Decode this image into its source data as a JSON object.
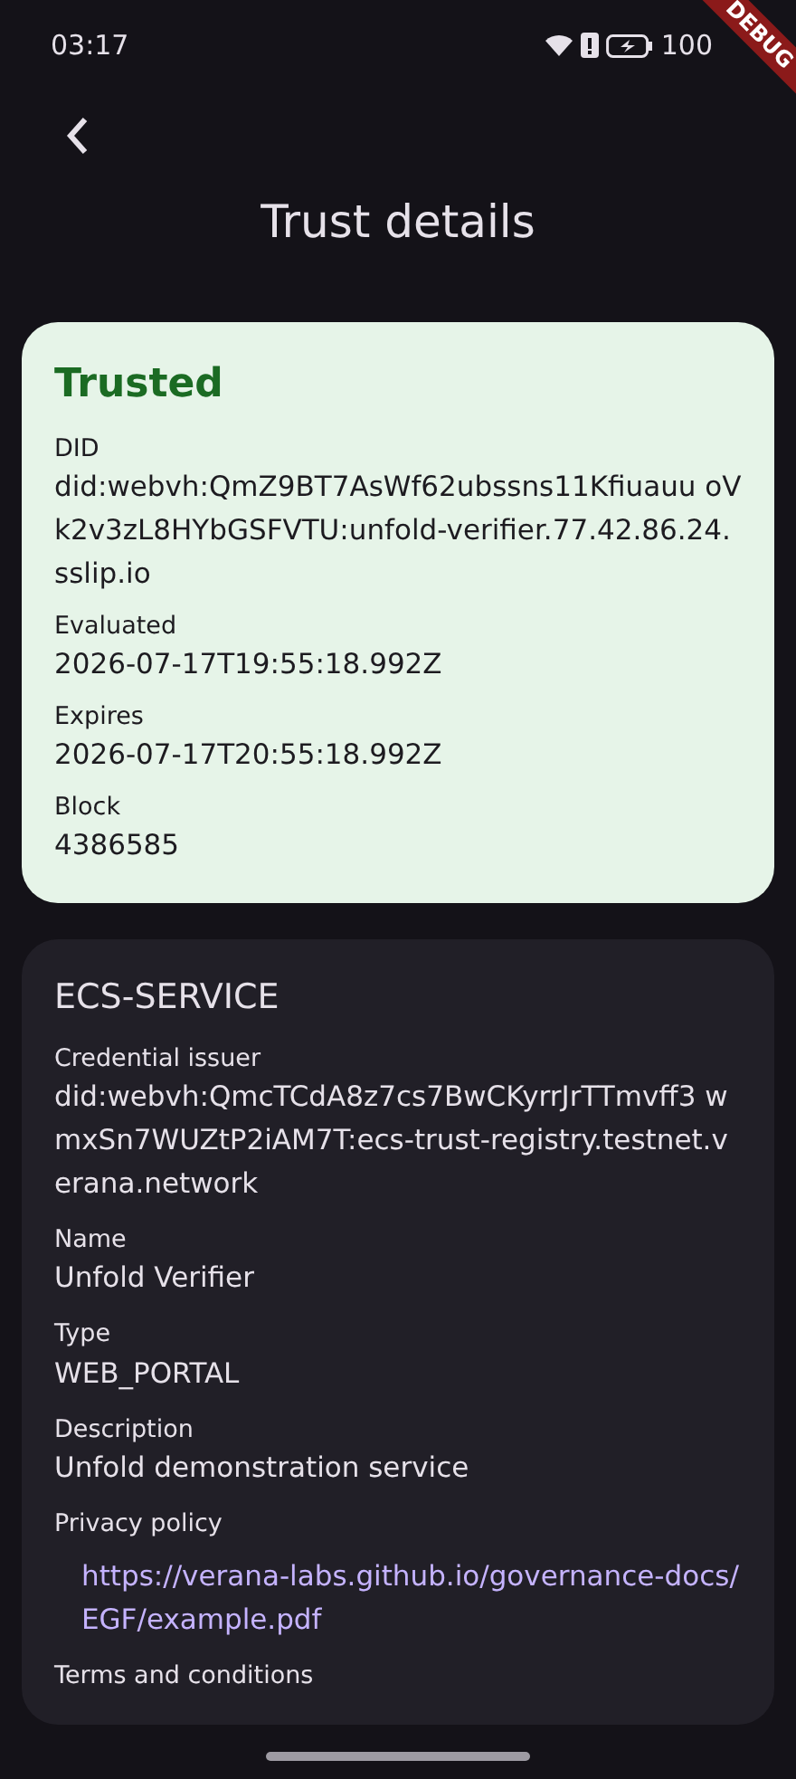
{
  "status_bar": {
    "time": "03:17",
    "battery": "100"
  },
  "debug_banner": "DEBUG",
  "header": {
    "title": "Trust details"
  },
  "trust_card": {
    "status": "Trusted",
    "trusted": true,
    "fields": [
      {
        "label": "DID",
        "value": "did:webvh:QmZ9BT7AsWf62ubssns11Kfiuauu oVk2v3zL8HYbGSFVTU:unfold-verifier.77.42.86.24.sslip.io"
      },
      {
        "label": "Evaluated",
        "value": "2026-07-17T19:55:18.992Z"
      },
      {
        "label": "Expires",
        "value": "2026-07-17T20:55:18.992Z"
      },
      {
        "label": "Block",
        "value": "4386585"
      }
    ]
  },
  "service_card": {
    "title": "ECS-SERVICE",
    "fields": [
      {
        "label": "Credential issuer",
        "value": "did:webvh:QmcTCdA8z7cs7BwCKyrrJrTTmvff3 wmxSn7WUZtP2iAM7T:ecs-trust-registry.testnet.verana.network",
        "kind": "text"
      },
      {
        "label": "Name",
        "value": "Unfold Verifier",
        "kind": "text"
      },
      {
        "label": "Type",
        "value": "WEB_PORTAL",
        "kind": "text"
      },
      {
        "label": "Description",
        "value": "Unfold demonstration service",
        "kind": "text"
      },
      {
        "label": "Privacy policy",
        "value": "https://verana-labs.github.io/governance-docs/EGF/example.pdf",
        "kind": "link"
      },
      {
        "label": "Terms and conditions"
      }
    ]
  }
}
